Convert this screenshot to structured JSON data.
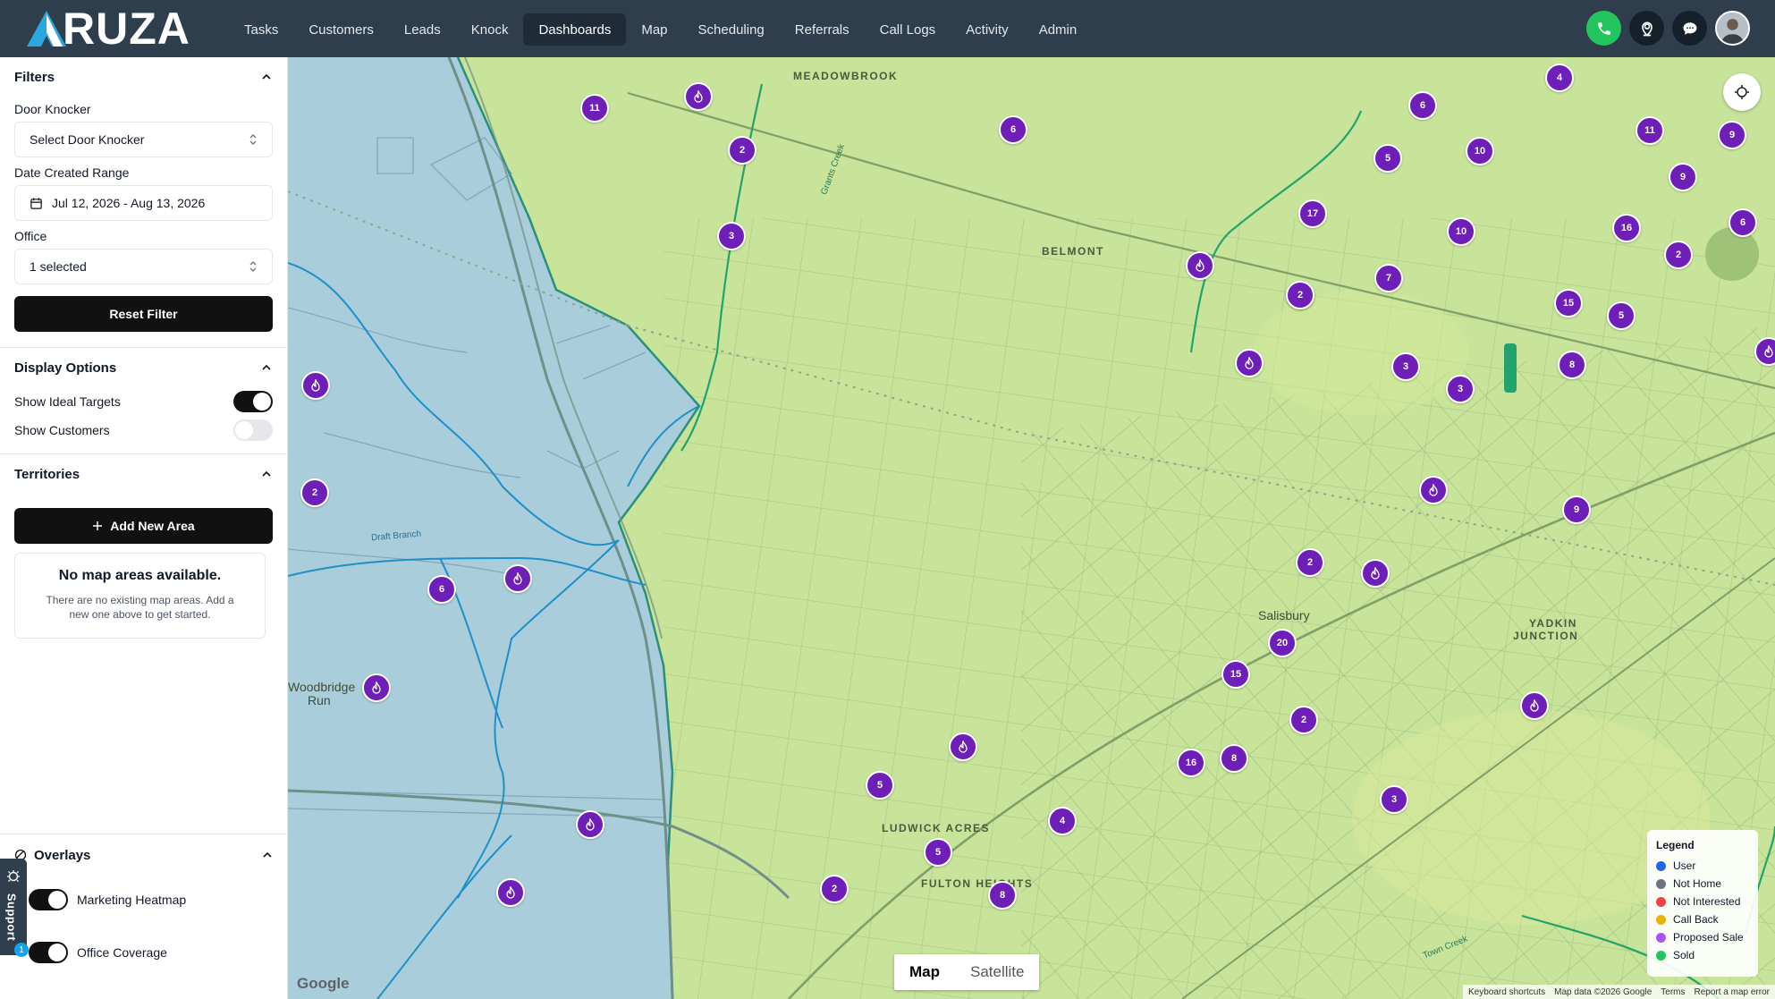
{
  "app": {
    "logo_text": "RUZA"
  },
  "nav": {
    "items": [
      "Tasks",
      "Customers",
      "Leads",
      "Knock",
      "Dashboards",
      "Map",
      "Scheduling",
      "Referrals",
      "Call Logs",
      "Activity",
      "Admin"
    ],
    "active": "Dashboards"
  },
  "top_actions": [
    "phone-icon",
    "map-pin-icon",
    "chat-icon",
    "avatar"
  ],
  "filters": {
    "title": "Filters",
    "door_knocker_label": "Door Knocker",
    "door_knocker_value": "Select Door Knocker",
    "date_range_label": "Date Created Range",
    "date_range_value": "Jul 12, 2026 - Aug 13, 2026",
    "office_label": "Office",
    "office_value": "1 selected",
    "reset_label": "Reset Filter"
  },
  "display_options": {
    "title": "Display Options",
    "ideal_targets_label": "Show Ideal Targets",
    "ideal_targets_on": true,
    "customers_label": "Show Customers",
    "customers_on": false
  },
  "territories": {
    "title": "Territories",
    "add_label": "Add New Area",
    "empty_title": "No map areas available.",
    "empty_desc": "There are no existing map areas. Add a new one above to get started."
  },
  "overlays": {
    "title": "Overlays",
    "marketing_heatmap_label": "Marketing Heatmap",
    "marketing_heatmap_on": true,
    "office_coverage_label": "Office Coverage",
    "office_coverage_on": true
  },
  "support": {
    "label": "Support",
    "badge": "1"
  },
  "map": {
    "places": {
      "meadowbrook": "MEADOWBROOK",
      "belmont": "BELMONT",
      "salisbury": "Salisbury",
      "yadkin_1": "YADKIN",
      "yadkin_2": "JUNCTION",
      "woodbridge_1": "Woodbridge",
      "woodbridge_2": "Run",
      "ludwick": "LUDWICK ACRES",
      "fulton": "FULTON HEIGHTS",
      "grants_creek": "Grants Creek",
      "draft_branch": "Draft Branch",
      "town_creek": "Town Creek"
    },
    "clusters": [
      "11",
      "2",
      "3",
      "6",
      "17",
      "7",
      "2",
      "5",
      "10",
      "10",
      "6",
      "4",
      "11",
      "9",
      "9",
      "16",
      "6",
      "2",
      "15",
      "5",
      "8",
      "3",
      "3",
      "9",
      "2",
      "20",
      "15",
      "2",
      "16",
      "8",
      "3",
      "2",
      "6",
      "2",
      "5",
      "4",
      "5",
      "8",
      "2"
    ],
    "map_type": {
      "map_label": "Map",
      "satellite_label": "Satellite",
      "selected": "Map"
    },
    "google_label": "Google",
    "attribution": [
      "Keyboard shortcuts",
      "Map data ©2026 Google",
      "Terms",
      "Report a map error"
    ]
  },
  "legend": {
    "title": "Legend",
    "items": [
      {
        "label": "User",
        "color": "#2563eb"
      },
      {
        "label": "Not Home",
        "color": "#6b7280"
      },
      {
        "label": "Not Interested",
        "color": "#ef4444"
      },
      {
        "label": "Call Back",
        "color": "#eab308"
      },
      {
        "label": "Proposed Sale",
        "color": "#a855f7"
      },
      {
        "label": "Sold",
        "color": "#22c55e"
      }
    ]
  }
}
